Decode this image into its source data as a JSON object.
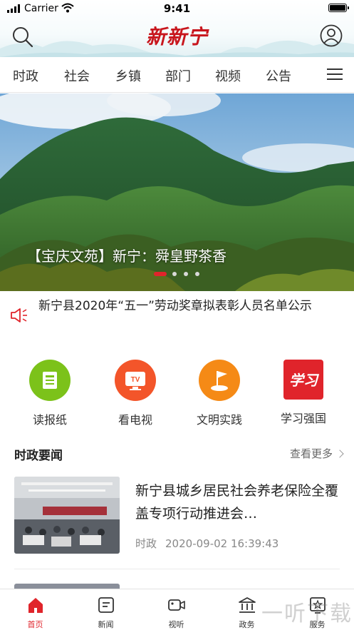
{
  "status_bar": {
    "carrier": "Carrier",
    "time": "9:41"
  },
  "header": {
    "logo": "新新宁",
    "search_icon": "search-icon",
    "user_icon": "user-icon"
  },
  "tabs": [
    {
      "label": "时政"
    },
    {
      "label": "社会"
    },
    {
      "label": "乡镇"
    },
    {
      "label": "部门"
    },
    {
      "label": "视频"
    },
    {
      "label": "公告"
    }
  ],
  "banner": {
    "caption": "【宝庆文苑】新宁：舜皇野茶香",
    "slide_count": 4,
    "active_slide": 1
  },
  "notice": {
    "icon": "speaker-icon",
    "text": "新宁县2020年“五一”劳动奖章拟表彰人员名单公示"
  },
  "quick_links": [
    {
      "label": "读报纸",
      "icon": "newspaper-icon",
      "color": "#7cc21a"
    },
    {
      "label": "看电视",
      "icon": "tv-icon",
      "color": "#f3552a"
    },
    {
      "label": "文明实践",
      "icon": "flag-icon",
      "color": "#f58a16"
    },
    {
      "label": "学习强国",
      "icon": "xuexi-icon",
      "color": "#e0242b"
    }
  ],
  "section": {
    "title": "时政要闻",
    "more": "查看更多"
  },
  "news": [
    {
      "title": "新宁县城乡居民社会养老保险全覆盖专项行动推进会…",
      "category": "时政",
      "datetime": "2020-09-02 16:39:43"
    }
  ],
  "tabbar": [
    {
      "label": "首页",
      "icon": "home-icon",
      "active": true
    },
    {
      "label": "新闻",
      "icon": "news-icon",
      "active": false
    },
    {
      "label": "视听",
      "icon": "video-icon",
      "active": false
    },
    {
      "label": "政务",
      "icon": "government-icon",
      "active": false
    },
    {
      "label": "服务",
      "icon": "service-icon",
      "active": false
    }
  ],
  "watermark": "一听下载",
  "colors": {
    "accent": "#e0242b",
    "logo": "#c8161d"
  }
}
